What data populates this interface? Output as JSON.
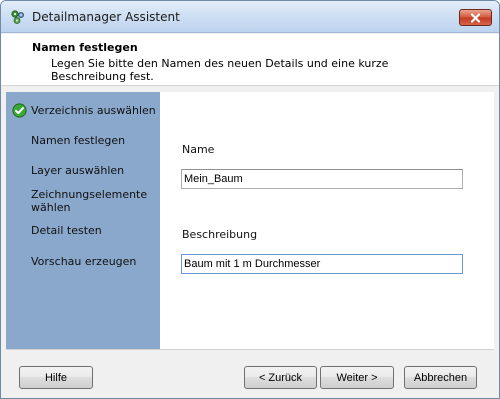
{
  "window": {
    "title": "Detailmanager Assistent",
    "app_icon": "gear-cluster-icon",
    "close_icon": "close-icon"
  },
  "header": {
    "title": "Namen festlegen",
    "description": "Legen Sie bitte den Namen des neuen Details und eine kurze Beschreibung fest."
  },
  "steps": [
    {
      "label": "Verzeichnis auswählen",
      "completed": true
    },
    {
      "label": "Namen festlegen",
      "completed": false
    },
    {
      "label": "Layer auswählen",
      "completed": false
    },
    {
      "label": "Zeichnungselemente wählen",
      "completed": false
    },
    {
      "label": "Detail testen",
      "completed": false
    },
    {
      "label": "Vorschau erzeugen",
      "completed": false
    }
  ],
  "form": {
    "name_label": "Name",
    "name_value": "Mein_Baum",
    "description_label": "Beschreibung",
    "description_value": "Baum mit 1 m Durchmesser"
  },
  "buttons": {
    "help": "Hilfe",
    "back": "< Zurück",
    "next": "Weiter >",
    "cancel": "Abbrechen"
  },
  "colors": {
    "sidebar": "#8aa8cc",
    "close_button": "#c9462c",
    "check": "#2e9a2a"
  }
}
